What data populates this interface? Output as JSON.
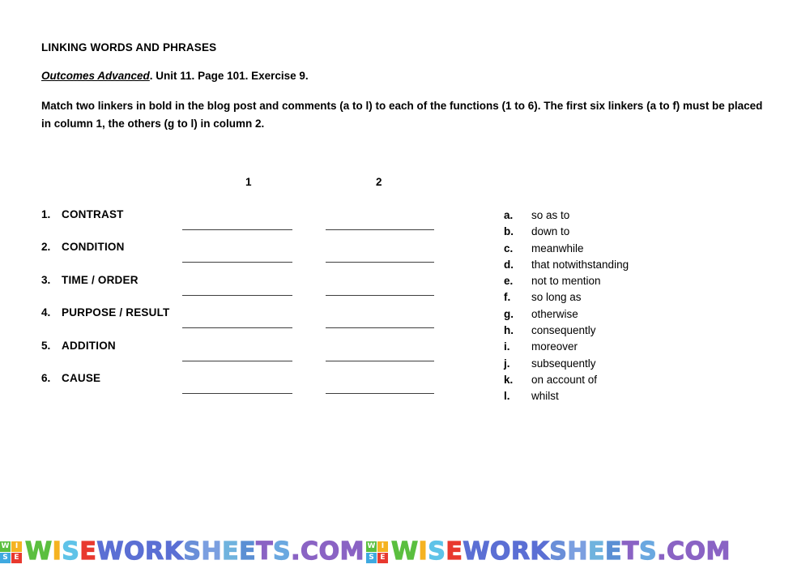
{
  "document": {
    "title": "LINKING WORDS AND PHRASES",
    "source_title": "Outcomes Advanced",
    "source_rest": ". Unit 11. Page 101. Exercise 9.",
    "instructions": "Match two linkers in bold in the blog post and comments (a to l) to each of the functions (1 to 6). The first six linkers (a to f) must be placed in column 1, the others (g to l) in column 2."
  },
  "columns": {
    "col1_heading": "1",
    "col2_heading": "2"
  },
  "functions": [
    {
      "number": "1.",
      "label": "CONTRAST",
      "answer1": "",
      "answer2": ""
    },
    {
      "number": "2.",
      "label": "CONDITION",
      "answer1": "",
      "answer2": ""
    },
    {
      "number": "3.",
      "label": "TIME / ORDER",
      "answer1": "",
      "answer2": ""
    },
    {
      "number": "4.",
      "label": "PURPOSE / RESULT",
      "answer1": "",
      "answer2": ""
    },
    {
      "number": "5.",
      "label": "ADDITION",
      "answer1": "",
      "answer2": ""
    },
    {
      "number": "6.",
      "label": "CAUSE",
      "answer1": "",
      "answer2": ""
    }
  ],
  "linkers": [
    {
      "letter": "a.",
      "text": "so as to"
    },
    {
      "letter": "b.",
      "text": "down to"
    },
    {
      "letter": "c.",
      "text": "meanwhile"
    },
    {
      "letter": "d.",
      "text": "that notwithstanding"
    },
    {
      "letter": "e.",
      "text": "not to mention"
    },
    {
      "letter": "f.",
      "text": "so long as"
    },
    {
      "letter": "g.",
      "text": "otherwise"
    },
    {
      "letter": "h.",
      "text": "consequently"
    },
    {
      "letter": "i.",
      "text": "moreover"
    },
    {
      "letter": "j.",
      "text": "subsequently"
    },
    {
      "letter": "k.",
      "text": "on account of"
    },
    {
      "letter": "l.",
      "text": "whilst"
    }
  ],
  "watermark": {
    "logo_cells": [
      {
        "letter": "W",
        "color": "#5bbf3f"
      },
      {
        "letter": "I",
        "color": "#f5b321"
      },
      {
        "letter": "S",
        "color": "#3fa9e0"
      },
      {
        "letter": "E",
        "color": "#e8392f"
      }
    ],
    "wordmark": "WISEWORKSHEETS.COM",
    "letter_colors": [
      "#5bbf3f",
      "#f5b321",
      "#5fc3e8",
      "#e8392f",
      "#5b6fd4",
      "#5b6fd4",
      "#5b6fd4",
      "#5b6fd4",
      "#6a8fd8",
      "#7b9fe0",
      "#6fb3de",
      "#5b8fd4",
      "#8a63c4",
      "#6aa8e0",
      "#8a63c4",
      "#8a63c4",
      "#8a63c4",
      "#8a63c4"
    ],
    "repeat_count": 2
  },
  "colors": {
    "page_background": "#ffffff",
    "text": "#000000",
    "rule_line": "#3f3f3f"
  }
}
